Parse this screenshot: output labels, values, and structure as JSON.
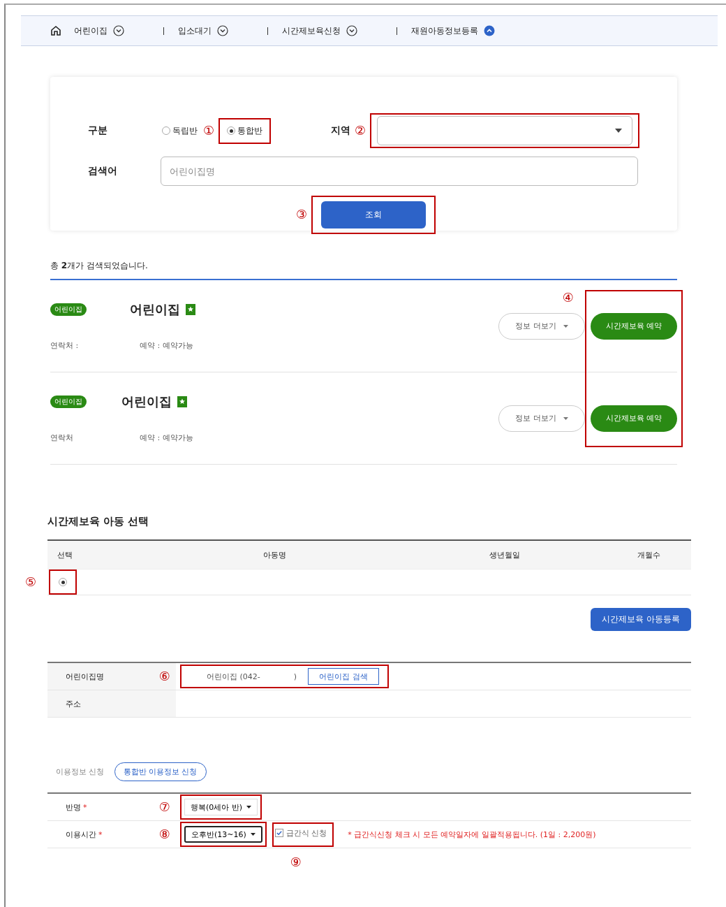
{
  "nav": {
    "items": [
      {
        "label": "어린이집",
        "expanded": false
      },
      {
        "label": "입소대기",
        "expanded": false
      },
      {
        "label": "시간제보육신청",
        "expanded": false
      },
      {
        "label": "재원아동정보등록",
        "expanded": true
      }
    ]
  },
  "search": {
    "type_label": "구분",
    "type_marker": "①",
    "type_options": [
      {
        "label": "독립반",
        "selected": false
      },
      {
        "label": "통합반",
        "selected": true
      }
    ],
    "region_label": "지역",
    "region_marker": "②",
    "keyword_label": "검색어",
    "keyword_placeholder": "어린이집명",
    "submit": {
      "label": "조회",
      "marker": "③"
    }
  },
  "results": {
    "summary": "총 **2**개가 검색되었습니다.",
    "reserve_marker": "④",
    "items": [
      {
        "badge": "어린이집",
        "name": "어린이집",
        "contact": "연락처 :",
        "reservation": "예약 : 예약가능",
        "more": "정보 더보기",
        "action": "시간제보육 예약"
      },
      {
        "badge": "어린이집",
        "name": "어린이집",
        "contact": "연락처",
        "reservation": "예약 : 예약가능",
        "more": "정보 더보기",
        "action": "시간제보육 예약"
      }
    ]
  },
  "children_section": {
    "title": "시간제보육 아동 선택",
    "columns": [
      "선택",
      "아동명",
      "생년월일",
      "개월수"
    ],
    "rows": [
      {
        "selected": true,
        "marker": "⑤"
      }
    ],
    "register_button": "시간제보육 아동등록"
  },
  "center_info": {
    "rows": [
      {
        "label": "어린이집명",
        "marker": "⑥",
        "value": "어린이집 (042-",
        "value_end": ")",
        "button": "어린이집 검색"
      },
      {
        "label": "주소"
      }
    ]
  },
  "usage_tabs": [
    {
      "label": "이용정보 신청",
      "selected": false
    },
    {
      "label": "통합반 이용정보 신청",
      "selected": true
    }
  ],
  "usage_form": {
    "class_label": "반명",
    "class_required_mark": "*",
    "class_marker": "⑦",
    "class_value": "행복(0세아 반)",
    "time_label": "이용시간",
    "time_required_mark": "*",
    "time_marker": "⑧",
    "time_value": "오후반(13~16)",
    "snack": {
      "label": "급간식 신청",
      "checked": true,
      "marker": "⑨"
    },
    "notice": "* 급간식신청 체크 시 모든 예약일자에 일괄적용됩니다. (1일 : 2,200원)"
  }
}
